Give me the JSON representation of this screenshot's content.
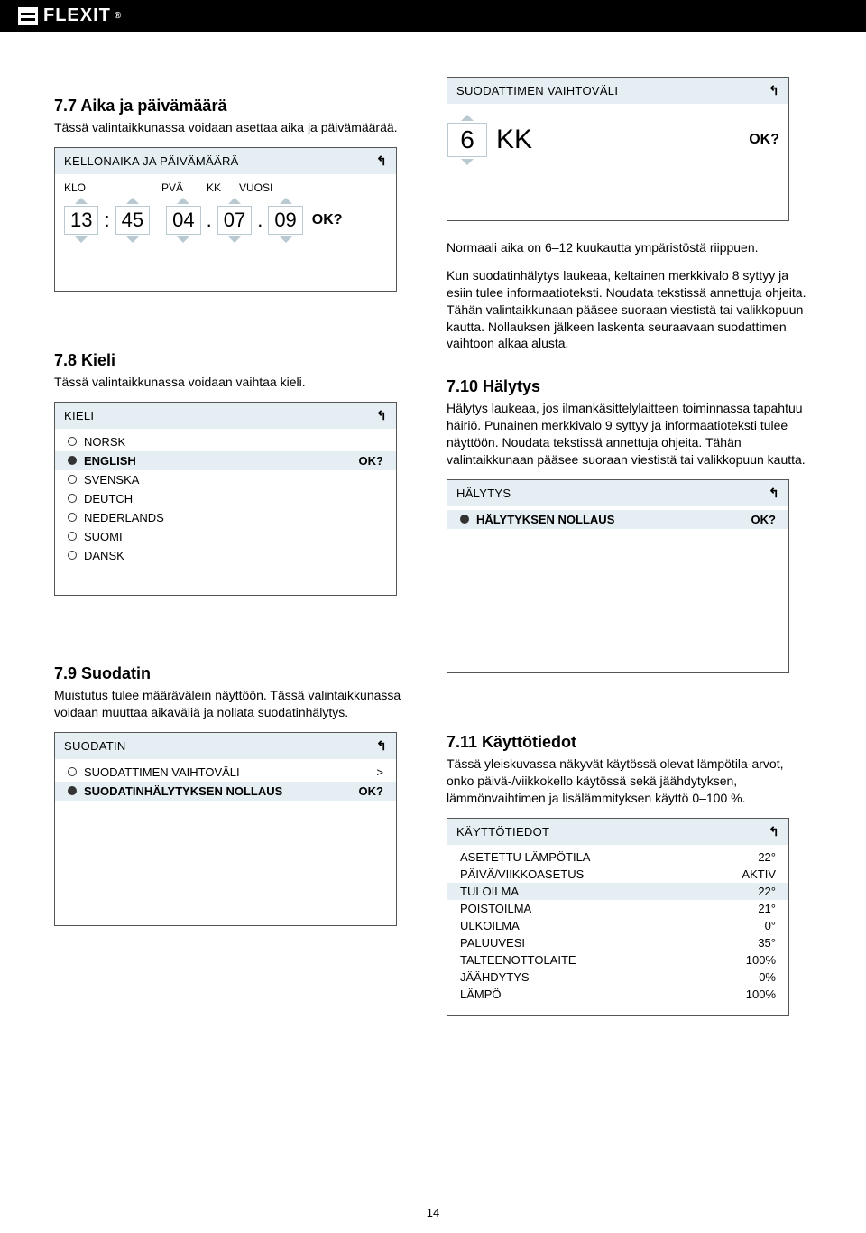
{
  "brand": "FLEXIT",
  "page_number": "14",
  "sections": {
    "s77": {
      "heading": "7.7   Aika ja päivämäärä",
      "text": "Tässä valintaikkunassa voidaan asettaa aika ja päivämäärää.",
      "panel_title": "KELLONAIKA JA PÄIVÄMÄÄRÄ",
      "labels": {
        "klo": "KLO",
        "pva": "PVÄ",
        "kk": "KK",
        "vuosi": "VUOSI"
      },
      "values": {
        "hh": "13",
        "mm": "45",
        "day": "04",
        "month": "07",
        "year": "09"
      },
      "ok": "OK?"
    },
    "s78": {
      "heading": "7.8   Kieli",
      "text": "Tässä valintaikkunassa voidaan vaihtaa kieli.",
      "panel_title": "KIELI",
      "ok": "OK?",
      "items": [
        "NORSK",
        "ENGLISH",
        "SVENSKA",
        "DEUTCH",
        "NEDERLANDS",
        "SUOMI",
        "DANSK"
      ]
    },
    "s79": {
      "heading": "7.9   Suodatin",
      "text": "Muistutus tulee määrävälein näyttöön. Tässä valintaikkunassa voidaan muuttaa aikaväliä ja nollata suodatinhälytys.",
      "panel_title": "SUODATIN",
      "items": [
        "SUODATTIMEN VAIHTOVÄLI",
        "SUODATINHÄLYTYKSEN NOLLAUS"
      ],
      "tail": [
        ">",
        "OK?"
      ]
    },
    "filter_interval": {
      "panel_title": "SUODATTIMEN VAIHTOVÄLI",
      "value": "6",
      "unit": "KK",
      "ok": "OK?",
      "caption": "Normaali aika on 6–12 kuukautta ympäristöstä riippuen.",
      "paragraph": "Kun suodatinhälytys laukeaa, keltainen merkkivalo 8 syttyy ja esiin tulee informaatioteksti. Noudata tekstissä annettuja ohjeita. Tähän valintaikkunaan pääsee suoraan viestistä tai valikkopuun kautta. Nollauksen jälkeen laskenta seuraavaan suodattimen vaihtoon alkaa alusta."
    },
    "s710": {
      "heading": "7.10 Hälytys",
      "text": "Hälytys laukeaa, jos ilmankäsittelylaitteen toiminnassa tapahtuu häiriö. Punainen merkkivalo 9 syttyy ja informaatioteksti tulee näyttöön. Noudata tekstissä annettuja ohjeita. Tähän valintaikkunaan pääsee suoraan viestistä tai valikkopuun kautta.",
      "panel_title": "HÄLYTYS",
      "item": "HÄLYTYKSEN NOLLAUS",
      "ok": "OK?"
    },
    "s711": {
      "heading": "7.11 Käyttötiedot",
      "text": "Tässä yleiskuvassa näkyvät käytössä olevat lämpötila-arvot, onko päivä-/viikkokello käytössä sekä jäähdytyksen, lämmönvaihtimen ja lisälämmityksen käyttö 0–100 %.",
      "panel_title": "KÄYTTÖTIEDOT",
      "rows": [
        {
          "k": "ASETETTU LÄMPÖTILA",
          "v": "22°"
        },
        {
          "k": "PÄIVÄ/VIIKKOASETUS",
          "v": "AKTIV"
        },
        {
          "k": "TULOILMA",
          "v": "22°"
        },
        {
          "k": "POISTOILMA",
          "v": "21°"
        },
        {
          "k": "ULKOILMA",
          "v": "0°"
        },
        {
          "k": "PALUUVESI",
          "v": "35°"
        },
        {
          "k": "TALTEENOTTOLAITE",
          "v": "100%"
        },
        {
          "k": "JÄÄHDYTYS",
          "v": "0%"
        },
        {
          "k": "LÄMPÖ",
          "v": "100%"
        }
      ]
    }
  }
}
